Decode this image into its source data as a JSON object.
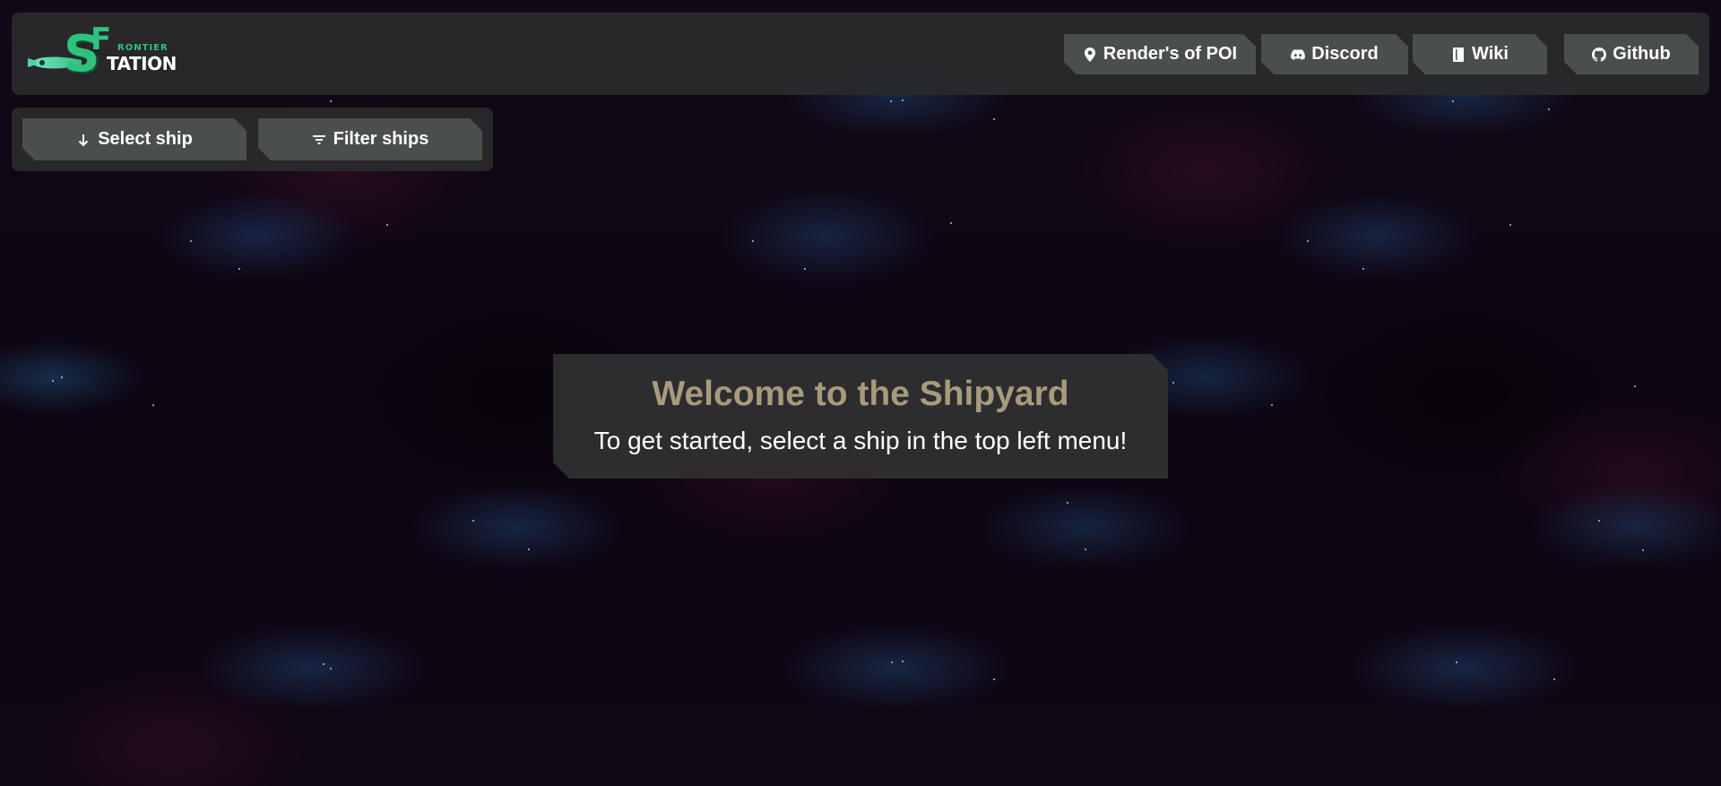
{
  "logo": {
    "letter_s": "S",
    "letter_f": "F",
    "word_frontier": "RONTIER",
    "word_station": "TATION",
    "colors": {
      "primary": "#2ec27e",
      "secondary": "#ffffff"
    }
  },
  "nav": {
    "items": [
      {
        "label": "Render's of POI",
        "icon": "map-pin-icon"
      },
      {
        "label": "Discord",
        "icon": "discord-icon"
      },
      {
        "label": "Wiki",
        "icon": "book-icon"
      },
      {
        "label": "Github",
        "icon": "github-icon"
      }
    ]
  },
  "toolbar": {
    "select_label": "Select ship",
    "select_icon": "arrow-down-icon",
    "filter_label": "Filter ships",
    "filter_icon": "filter-icon"
  },
  "welcome": {
    "title": "Welcome to the Shipyard",
    "subtitle": "To get started, select a ship in the top left menu!"
  },
  "theme": {
    "button_bg": "#4a4f4b",
    "panel_bg": "#2a2a2c",
    "title_color": "#a89a7b"
  }
}
